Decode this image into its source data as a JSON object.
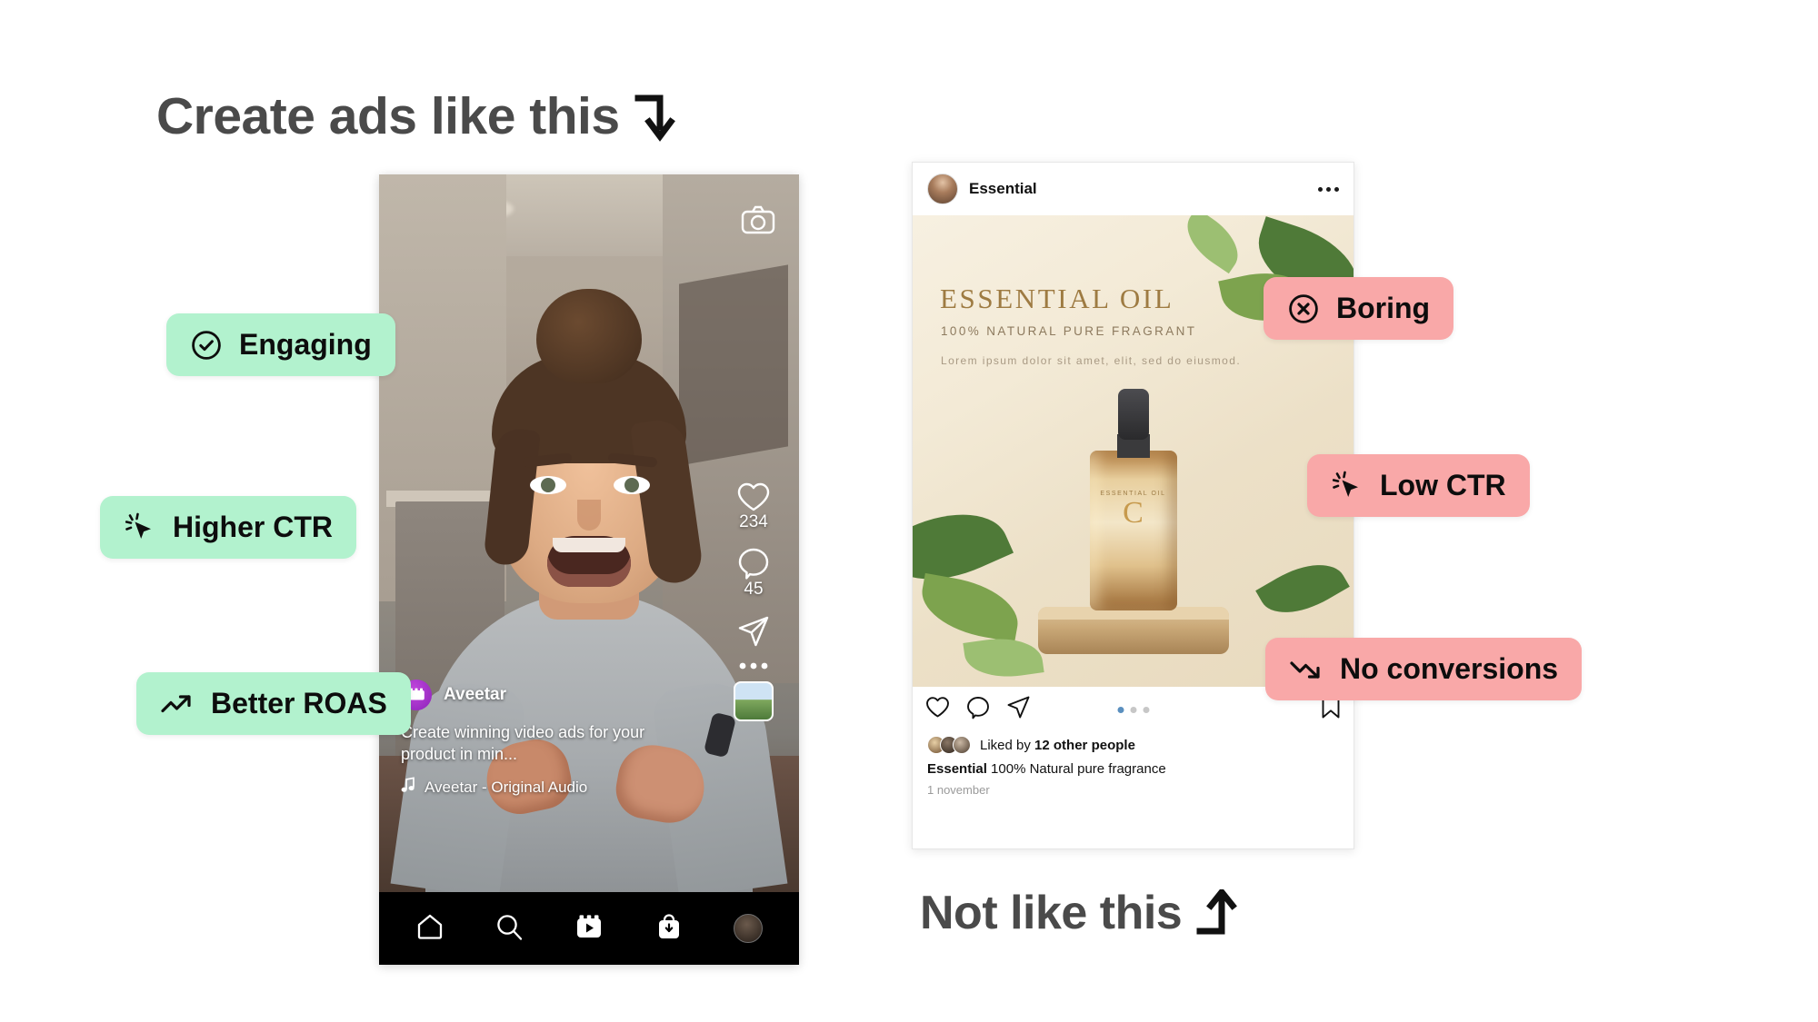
{
  "headings": {
    "top": "Create ads like this",
    "bottom": "Not like this"
  },
  "reel": {
    "camera_icon": "camera-icon",
    "likes": "234",
    "comments": "45",
    "account": "Aveetar",
    "description": "Create winning video ads for your product in min...",
    "audio": "Aveetar - Original Audio",
    "nav": [
      {
        "icon": "home-icon",
        "label": "Home"
      },
      {
        "icon": "search-icon",
        "label": "Search"
      },
      {
        "icon": "reels-icon",
        "label": "Reels"
      },
      {
        "icon": "shop-icon",
        "label": "Shop"
      },
      {
        "icon": "profile-avatar",
        "label": "Profile"
      }
    ]
  },
  "instagram": {
    "username": "Essential",
    "more_icon": "more-options-icon",
    "creative": {
      "title": "ESSENTIAL OIL",
      "subtitle": "100% NATURAL PURE FRAGRANT",
      "body": "Lorem ipsum dolor sit amet, elit, sed do eiusmod.",
      "bottle_label_top": "ESSENTIAL OIL",
      "bottle_label_big": "C"
    },
    "actions": {
      "like": "heart-icon",
      "comment": "comment-icon",
      "share": "share-icon",
      "save": "bookmark-icon"
    },
    "carousel_dots": 3,
    "carousel_active": 1,
    "liked_prefix": "Liked by ",
    "liked_count": "12 other people",
    "caption_user": "Essential",
    "caption_text": " 100% Natural pure fragrance",
    "date": "1 november"
  },
  "badges": {
    "good": [
      {
        "id": "engaging",
        "label": "Engaging",
        "icon": "circle-check-icon"
      },
      {
        "id": "higher-ctr",
        "label": "Higher CTR",
        "icon": "cursor-click-icon"
      },
      {
        "id": "better-roas",
        "label": "Better ROAS",
        "icon": "trending-up-icon"
      }
    ],
    "bad": [
      {
        "id": "boring",
        "label": "Boring",
        "icon": "circle-x-icon"
      },
      {
        "id": "low-ctr",
        "label": "Low CTR",
        "icon": "cursor-click-icon"
      },
      {
        "id": "no-conversions",
        "label": "No conversions",
        "icon": "trending-down-icon"
      }
    ]
  },
  "colors": {
    "good_badge": "#b2f2ce",
    "bad_badge": "#f9a8a8",
    "heading": "#4a4a4a",
    "background": "#ffffff"
  }
}
